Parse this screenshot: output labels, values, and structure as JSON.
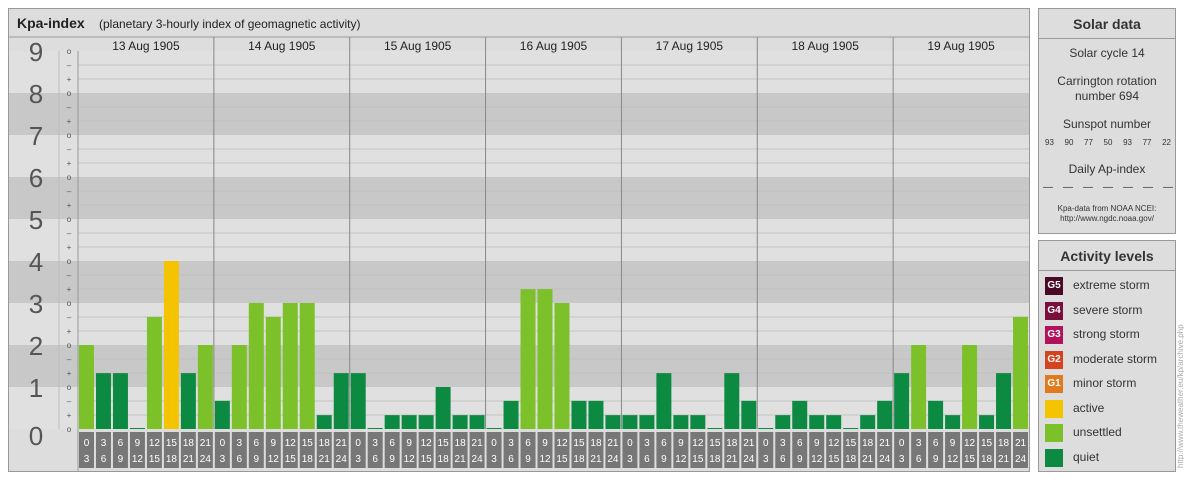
{
  "header": {
    "title": "Kpa-index",
    "subtitle": "(planetary 3-hourly index of geomagnetic activity)"
  },
  "chart_data": {
    "type": "bar",
    "title": "Kpa-index",
    "subtitle": "(planetary 3-hourly index of geomagnetic activity)",
    "ylim": [
      0,
      9
    ],
    "y_ticks": [
      "0",
      "1",
      "2",
      "3",
      "4",
      "5",
      "6",
      "7",
      "8",
      "9"
    ],
    "minor_tick_labels": [
      "o",
      "+",
      "–"
    ],
    "days": [
      "13 Aug 1905",
      "14 Aug 1905",
      "15 Aug 1905",
      "16 Aug 1905",
      "17 Aug 1905",
      "18 Aug 1905",
      "19 Aug 1905"
    ],
    "interval_labels": [
      [
        "0",
        "3"
      ],
      [
        "3",
        "6"
      ],
      [
        "6",
        "9"
      ],
      [
        "9",
        "12"
      ],
      [
        "12",
        "15"
      ],
      [
        "15",
        "18"
      ],
      [
        "18",
        "21"
      ],
      [
        "21",
        "24"
      ]
    ],
    "series": [
      {
        "name": "Kpa",
        "values": [
          [
            2.0,
            1.33,
            1.33,
            0.0,
            2.67,
            4.0,
            1.33,
            2.0
          ],
          [
            0.67,
            2.0,
            3.0,
            2.67,
            3.0,
            3.0,
            0.33,
            1.33
          ],
          [
            1.33,
            0.0,
            0.33,
            0.33,
            0.33,
            1.0,
            0.33,
            0.33
          ],
          [
            0.0,
            0.67,
            3.33,
            3.33,
            3.0,
            0.67,
            0.67,
            0.33
          ],
          [
            0.33,
            0.33,
            1.33,
            0.33,
            0.33,
            0.0,
            1.33,
            0.67
          ],
          [
            0.0,
            0.33,
            0.67,
            0.33,
            0.33,
            0.0,
            0.33,
            0.67
          ],
          [
            1.33,
            2.0,
            0.67,
            0.33,
            2.0,
            0.33,
            1.33,
            2.67
          ]
        ]
      }
    ],
    "bar_color_rules": {
      "quiet": "Kp < 2",
      "unsettled": "2 ≤ Kp < 4",
      "active": "Kp = 4"
    },
    "colors": {
      "quiet": "#0c8a42",
      "unsettled": "#7cc12a",
      "active": "#f5c400",
      "band_dark": "#c8c8c8",
      "band_light": "#e0e0e0",
      "tick_box": "#777777"
    }
  },
  "solar": {
    "title": "Solar data",
    "cycle": "Solar cycle 14",
    "carrington_line1": "Carrington rotation",
    "carrington_line2": "number 694",
    "sunspot_title": "Sunspot number",
    "sunspots": [
      "93",
      "90",
      "77",
      "50",
      "93",
      "77",
      "22"
    ],
    "ap_title": "Daily Ap-index",
    "ap_values": [
      "—",
      "—",
      "—",
      "—",
      "—",
      "—",
      "—"
    ],
    "source_line1": "Kpa-data from NOAA NCEI:",
    "source_line2": "http://www.ngdc.noaa.gov/"
  },
  "activity": {
    "title": "Activity levels",
    "levels": [
      {
        "code": "G5",
        "label": "extreme storm",
        "color": "#4a0a26"
      },
      {
        "code": "G4",
        "label": "severe storm",
        "color": "#7a0e3c"
      },
      {
        "code": "G3",
        "label": "strong storm",
        "color": "#b0135a"
      },
      {
        "code": "G2",
        "label": "moderate storm",
        "color": "#d4431c"
      },
      {
        "code": "G1",
        "label": "minor storm",
        "color": "#e07a1c"
      },
      {
        "code": "",
        "label": "active",
        "color": "#f5c400"
      },
      {
        "code": "",
        "label": "unsettled",
        "color": "#7cc12a"
      },
      {
        "code": "",
        "label": "quiet",
        "color": "#0c8a42"
      }
    ]
  },
  "credit": "http://www.theweather.eu/kp/archive.php"
}
